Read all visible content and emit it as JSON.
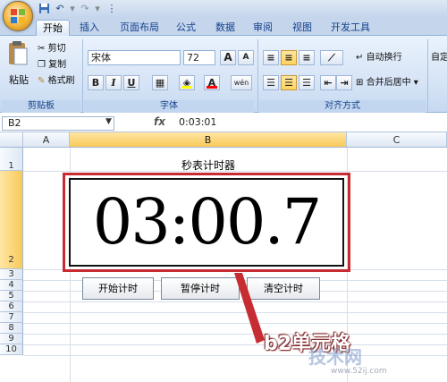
{
  "quick_access": {
    "save_icon": "save-icon",
    "undo_icon": "undo-icon",
    "redo_icon": "redo-icon"
  },
  "tabs": [
    {
      "label": "开始",
      "active": true
    },
    {
      "label": "插入"
    },
    {
      "label": "页面布局"
    },
    {
      "label": "公式"
    },
    {
      "label": "数据"
    },
    {
      "label": "审阅"
    },
    {
      "label": "视图"
    },
    {
      "label": "开发工具"
    }
  ],
  "ribbon": {
    "clipboard": {
      "paste": "粘贴",
      "cut": "剪切",
      "copy": "复制",
      "format_painter": "格式刷",
      "group_label": "剪贴板"
    },
    "font": {
      "name": "宋体",
      "size": "72",
      "grow": "A",
      "shrink": "A",
      "bold": "B",
      "italic": "I",
      "underline": "U",
      "fill_color": "#ffff00",
      "font_color": "#ff0000",
      "phonetic": "wén",
      "group_label": "字体"
    },
    "alignment": {
      "wrap_text": "自动换行",
      "merge_center": "合并后居中",
      "group_label": "对齐方式"
    },
    "number": {
      "label": "自定"
    }
  },
  "formula_bar": {
    "name_box": "B2",
    "fx": "fx",
    "value": "0:03:01"
  },
  "columns": [
    {
      "label": "A"
    },
    {
      "label": "B",
      "selected": true
    },
    {
      "label": "C"
    }
  ],
  "rows": [
    "1",
    "2",
    "3",
    "4",
    "5",
    "6",
    "7",
    "8",
    "9",
    "10"
  ],
  "sheet": {
    "title": "秒表计时器",
    "timer": "03:00.7",
    "buttons": [
      "开始计时",
      "暂停计时",
      "清空计时"
    ]
  },
  "annotation": {
    "label": "b2单元格",
    "color": "#c62c32"
  },
  "watermark": {
    "main": "技术网",
    "url": "www.52ij.com"
  }
}
